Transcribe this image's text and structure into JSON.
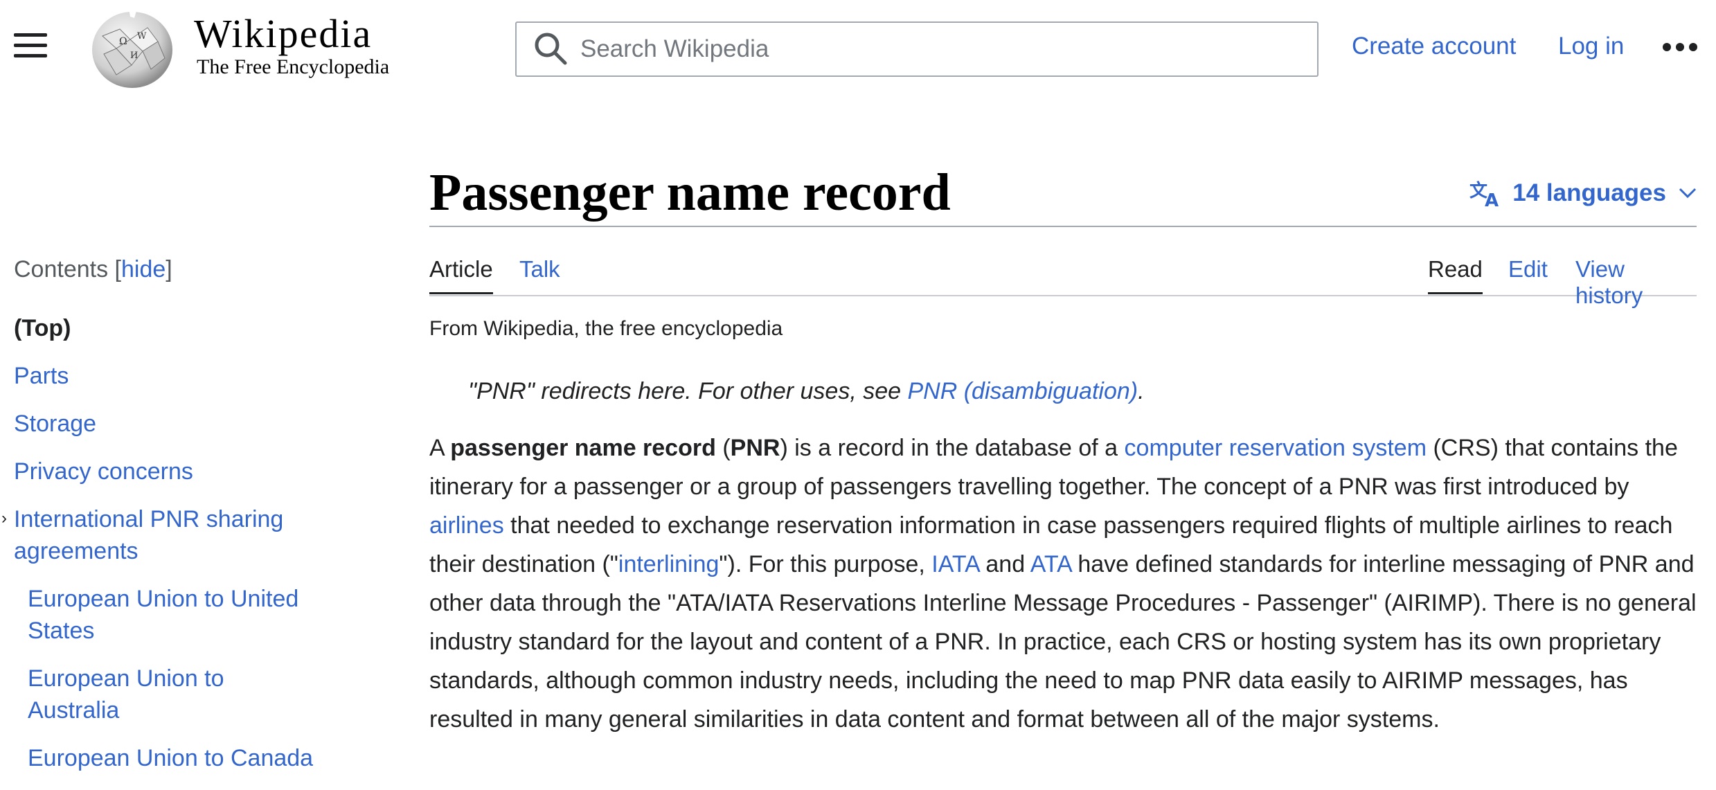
{
  "header": {
    "wordmark_title": "Wikipedia",
    "wordmark_tagline": "The Free Encyclopedia",
    "search_placeholder": "Search Wikipedia",
    "create_account": "Create account",
    "log_in": "Log in",
    "icons": [
      "menu-icon",
      "wikipedia-globe-logo",
      "search-icon",
      "more-options-icon"
    ]
  },
  "toc": {
    "heading": "Contents",
    "hide_open": "[",
    "hide_label": "hide",
    "hide_close": "]",
    "items": [
      {
        "label": "(Top)"
      },
      {
        "label": "Parts"
      },
      {
        "label": "Storage"
      },
      {
        "label": "Privacy concerns"
      },
      {
        "label": "International PNR sharing agreements"
      },
      {
        "label": "European Union to United States"
      },
      {
        "label": "European Union to Australia"
      },
      {
        "label": "European Union to Canada"
      }
    ]
  },
  "article": {
    "title": "Passenger name record",
    "languages": "14 languages",
    "tabs_left": [
      "Article",
      "Talk"
    ],
    "tabs_right": [
      "Read",
      "Edit",
      "View history"
    ],
    "tagline": "From Wikipedia, the free encyclopedia",
    "hatnote_prefix": "\"PNR\" redirects here. For other uses, see ",
    "hatnote_link": "PNR (disambiguation)",
    "hatnote_suffix": ".",
    "p1": [
      "A ",
      "passenger name record",
      " (",
      "PNR",
      ") is a record in the database of a ",
      "computer reservation system",
      " (CRS) that contains the itinerary for a passenger or a group of passengers travelling together. The concept of a PNR was first introduced by ",
      "airlines",
      " that needed to exchange reservation information in case passengers required flights of multiple airlines to reach their destination (\"",
      "interlining",
      "\"). For this purpose, ",
      "IATA",
      " and ",
      "ATA",
      " have defined standards for interline messaging of PNR and other data through the \"ATA/IATA Reservations Interline Message Procedures - Passenger\" (AIRIMP). There is no general industry standard for the layout and content of a PNR. In practice, each CRS or hosting system has its own proprietary standards, although common industry needs, including the need to map PNR data easily to AIRIMP messages, has resulted in many general similarities in data content and format between all of the major systems."
    ]
  },
  "colors": {
    "link": "#3366cc",
    "text": "#202122",
    "border": "#a2a9b1"
  }
}
